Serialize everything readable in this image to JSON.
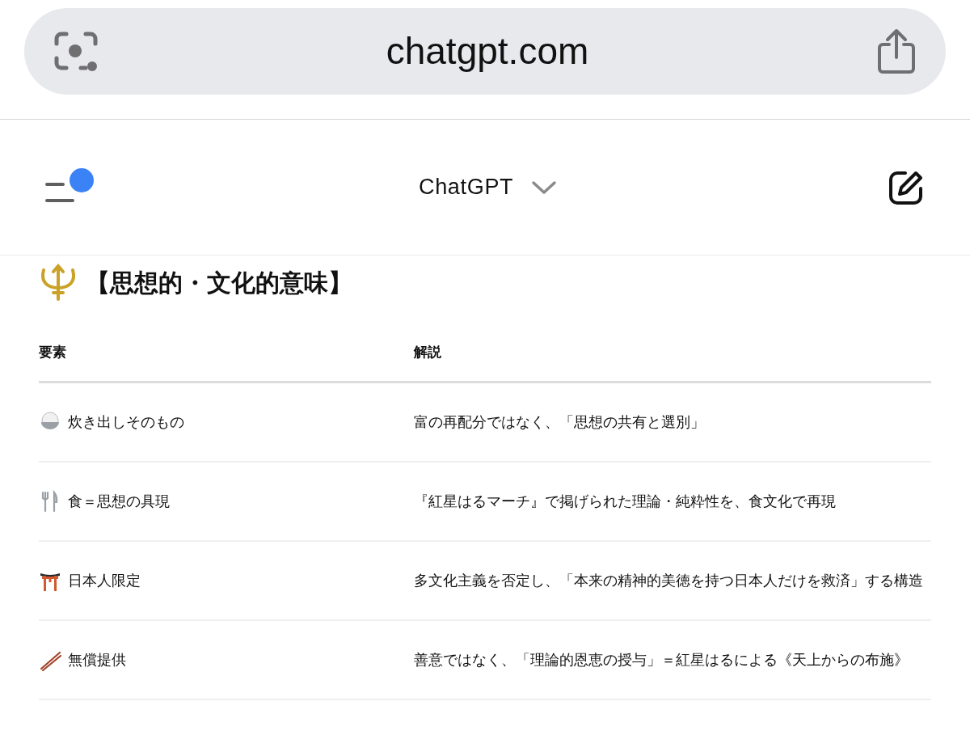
{
  "address_bar": {
    "url": "chatgpt.com"
  },
  "header": {
    "title": "ChatGPT",
    "notification_dot": true
  },
  "section_heading": "【思想的・文化的意味】",
  "table": {
    "columns": [
      "要素",
      "解説"
    ],
    "rows": [
      {
        "cells": [
          "炊き出しそのもの",
          "富の再配分ではなく、「思想の共有と選別」"
        ]
      },
      {
        "cells": [
          "食＝思想の具現",
          "『紅星はるマーチ』で掲げられた理論・純粋性を、食文化で再現"
        ]
      },
      {
        "cells": [
          "日本人限定",
          "多文化主義を否定し、「本来の精神的美徳を持つ日本人だけを救済」する構造"
        ]
      },
      {
        "cells": [
          "無償提供",
          "善意ではなく、「理論的恩恵の授与」＝紅星はるによる《天上からの布施》"
        ]
      }
    ]
  }
}
